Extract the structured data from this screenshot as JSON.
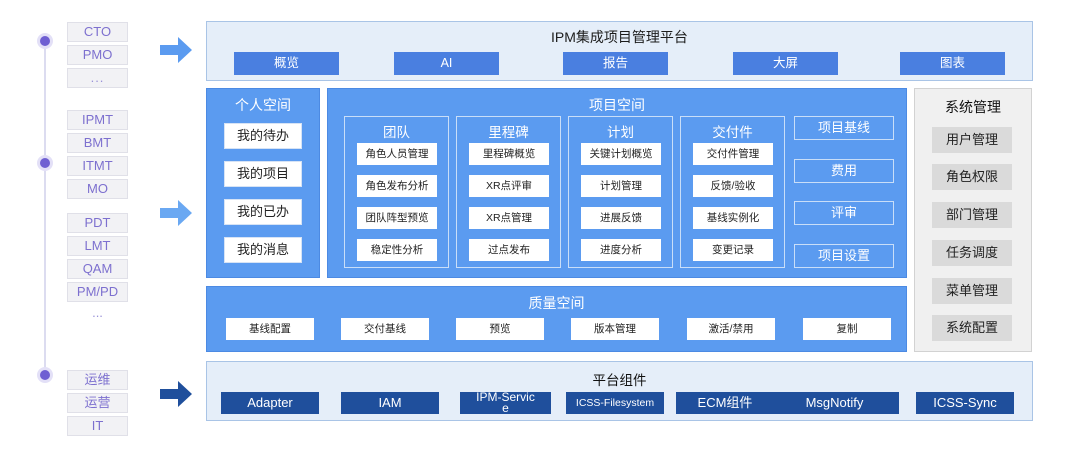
{
  "roles": {
    "group1": [
      "CTO",
      "PMO",
      "..."
    ],
    "group2": [
      "IPMT",
      "BMT",
      "ITMT",
      "MO"
    ],
    "group3": [
      "PDT",
      "LMT",
      "QAM",
      "PM/PD",
      "..."
    ],
    "group4": [
      "运维",
      "运营",
      "IT"
    ]
  },
  "platform": {
    "title": "IPM集成项目管理平台",
    "nav": [
      "概览",
      "AI",
      "报告",
      "大屏",
      "图表"
    ]
  },
  "personal": {
    "title": "个人空间",
    "items": [
      "我的待办",
      "我的项目",
      "我的已办",
      "我的消息"
    ]
  },
  "project": {
    "title": "项目空间",
    "groups": [
      {
        "title": "团队",
        "items": [
          "角色人员管理",
          "角色发布分析",
          "团队阵型预览",
          "稳定性分析"
        ]
      },
      {
        "title": "里程碑",
        "items": [
          "里程碑概览",
          "XR点评审",
          "XR点管理",
          "过点发布"
        ]
      },
      {
        "title": "计划",
        "items": [
          "关键计划概览",
          "计划管理",
          "进展反馈",
          "进度分析"
        ]
      },
      {
        "title": "交付件",
        "items": [
          "交付件管理",
          "反馈/验收",
          "基线实例化",
          "变更记录"
        ]
      }
    ],
    "side": [
      "项目基线",
      "费用",
      "评审",
      "项目设置"
    ]
  },
  "quality": {
    "title": "质量空间",
    "items": [
      "基线配置",
      "交付基线",
      "预览",
      "版本管理",
      "激活/禁用",
      "复制"
    ]
  },
  "system": {
    "title": "系统管理",
    "items": [
      "用户管理",
      "角色权限",
      "部门管理",
      "任务调度",
      "菜单管理",
      "系统配置"
    ]
  },
  "components": {
    "title": "平台组件",
    "items": [
      "Adapter",
      "IAM",
      "IPM-Service",
      "ICSS-Filesystem",
      "ECM组件",
      "MsgNotify",
      "ICSS-Sync"
    ]
  },
  "colors": {
    "accent": "#5b9bf0",
    "nav": "#4a7fe0",
    "component": "#1f4f9c",
    "role_text": "#7d70cf"
  }
}
